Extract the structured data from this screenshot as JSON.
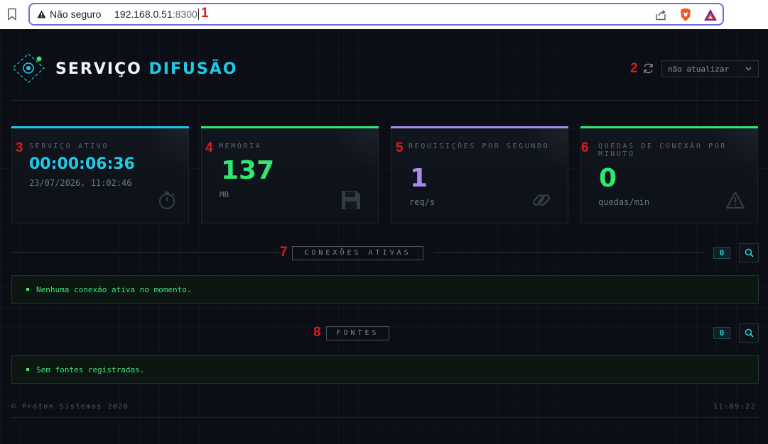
{
  "browser": {
    "security_label": "Não seguro",
    "url_host": "192.168.0.51",
    "url_port": ":8300"
  },
  "annotations": [
    "1",
    "2",
    "3",
    "4",
    "5",
    "6",
    "7",
    "8"
  ],
  "header": {
    "brand_part1": "SERVIÇO",
    "brand_part2": "DIFUSÃO",
    "refresh_select_value": "não atualizar"
  },
  "cards": [
    {
      "label": "SERVIÇO ATIVO",
      "value": "00:00:06:36",
      "sub": "23/07/2026, 11:02:46",
      "icon": "stopwatch-icon",
      "color": "#22c9e6"
    },
    {
      "label": "MEMÓRIA",
      "value": "137",
      "sub": "MB",
      "icon": "floppy-disk-icon",
      "color": "#2ee872"
    },
    {
      "label": "REQUISIÇÕES POR SEGUNDO",
      "value": "1",
      "sub": "req/s",
      "icon": "link-icon",
      "color": "#a98bf0"
    },
    {
      "label": "QUEDAS DE CONEXÃO POR MINUTO",
      "value": "0",
      "sub": "quedas/min",
      "icon": "warning-icon",
      "color": "#2ee872"
    }
  ],
  "sections": {
    "connections": {
      "title": "CONEXÕES ATIVAS",
      "count": "0",
      "empty_message": "Nenhuma conexão ativa no momento."
    },
    "sources": {
      "title": "FONTES",
      "count": "0",
      "empty_message": "Sem fontes registradas."
    }
  },
  "footer": {
    "copyright": "© Próton Sistemas 2026",
    "clock": "11:09:22"
  },
  "colors": {
    "accent_cyan": "#22c9e6",
    "accent_green": "#2ee872",
    "accent_purple": "#a98bf0",
    "annotation_red": "#e0191e"
  }
}
